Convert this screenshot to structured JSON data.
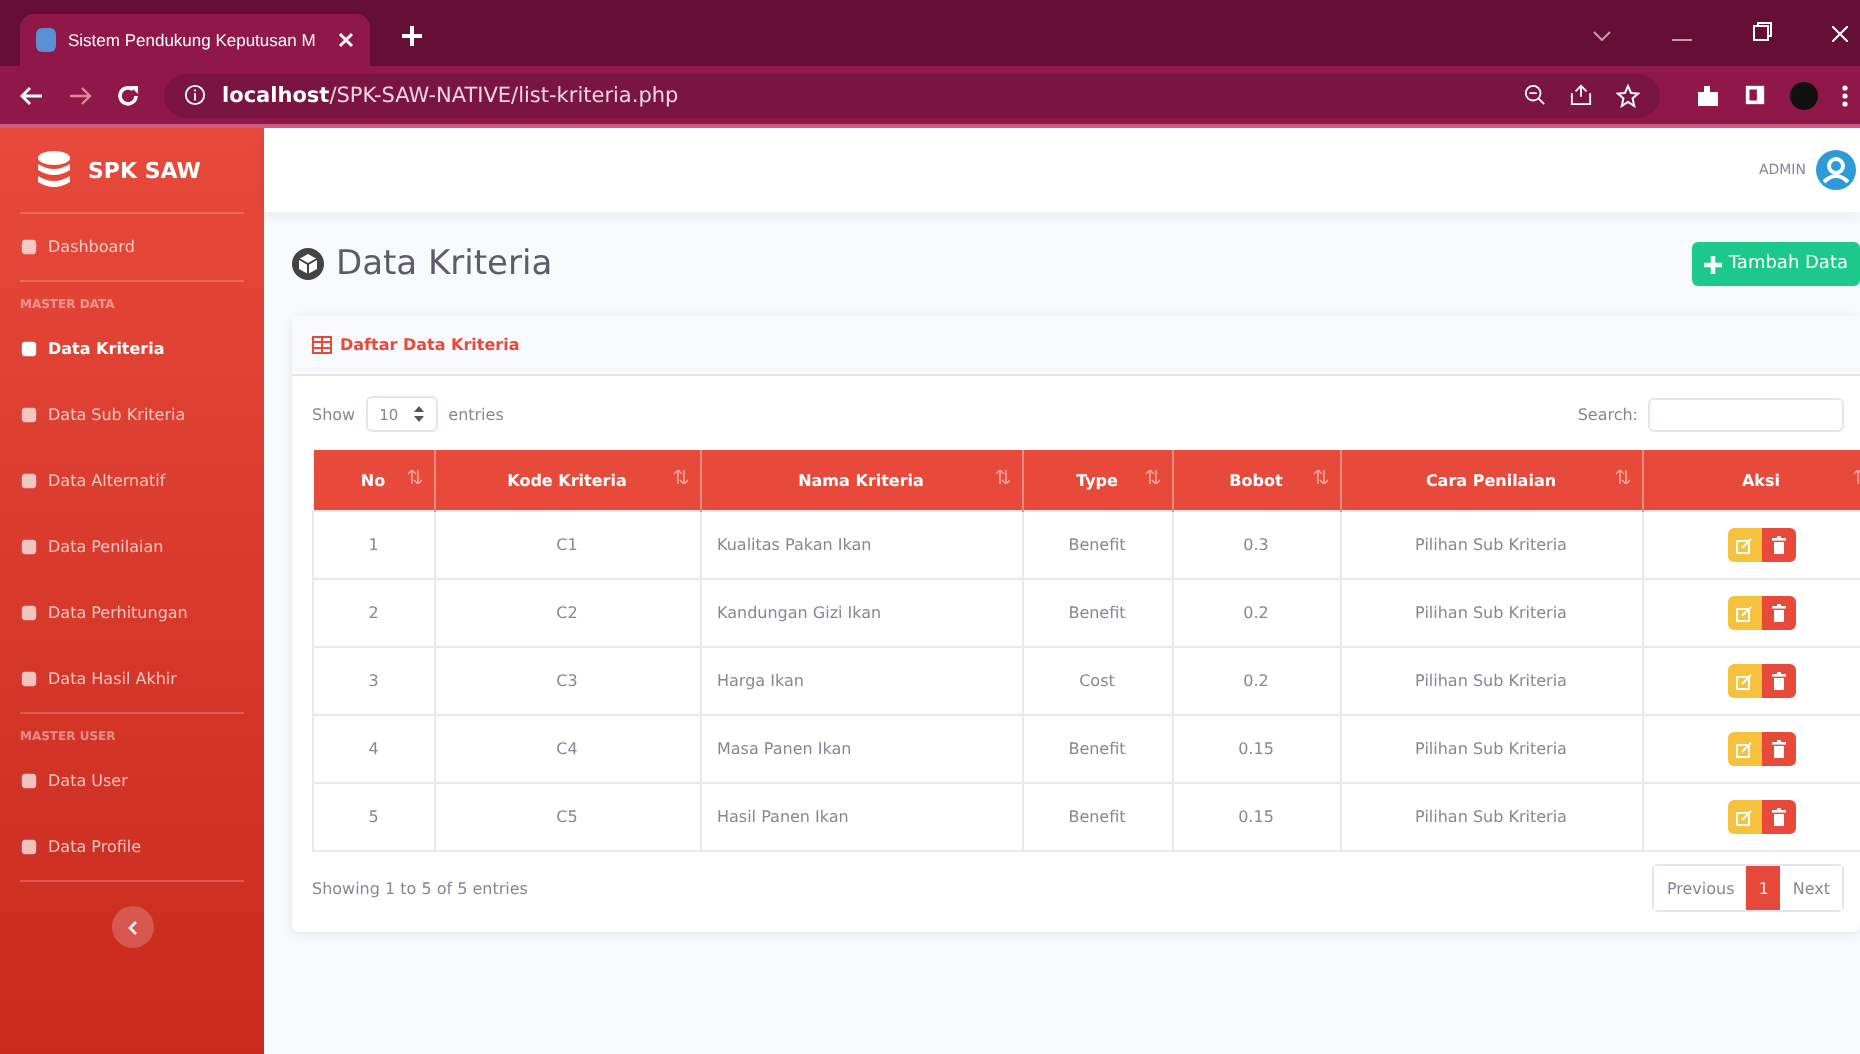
{
  "browser": {
    "tab_title": "Sistem Pendukung Keputusan M",
    "url": "**localhost**/SPK-SAW-NATIVE/list-kriteria.php"
  },
  "sidebar": {
    "brand": "SPK SAW",
    "sections": [
      {
        "items": [
          {
            "label": "Dashboard",
            "selected": false
          }
        ]
      },
      {
        "heading": "MASTER DATA",
        "items": [
          {
            "label": "Data Kriteria",
            "selected": true
          },
          {
            "label": "Data Sub Kriteria",
            "selected": false
          },
          {
            "label": "Data Alternatif",
            "selected": false
          },
          {
            "label": "Data Penilaian",
            "selected": false
          },
          {
            "label": "Data Perhitungan",
            "selected": false
          },
          {
            "label": "Data Hasil Akhir",
            "selected": false
          }
        ]
      },
      {
        "heading": "MASTER USER",
        "items": [
          {
            "label": "Data User",
            "selected": false
          },
          {
            "label": "Data Profile",
            "selected": false
          }
        ]
      }
    ]
  },
  "topbar": {
    "user": "ADMIN"
  },
  "page": {
    "title": "Data Kriteria",
    "add_button": "Tambah Data"
  },
  "card": {
    "title": "Daftar Data Kriteria",
    "show_label": "Show",
    "entries_value": "10",
    "entries_label": "entries",
    "search_label": "Search:",
    "table": {
      "columns": [
        "No",
        "Kode Kriteria",
        "Nama Kriteria",
        "Type",
        "Bobot",
        "Cara Penilaian",
        "Aksi"
      ],
      "rows": [
        [
          "1",
          "C1",
          "Kualitas Pakan Ikan",
          "Benefit",
          "0.3",
          "Pilihan Sub Kriteria"
        ],
        [
          "2",
          "C2",
          "Kandungan Gizi Ikan",
          "Benefit",
          "0.2",
          "Pilihan Sub Kriteria"
        ],
        [
          "3",
          "C3",
          "Harga Ikan",
          "Cost",
          "0.2",
          "Pilihan Sub Kriteria"
        ],
        [
          "4",
          "C4",
          "Masa Panen Ikan",
          "Benefit",
          "0.15",
          "Pilihan Sub Kriteria"
        ],
        [
          "5",
          "C5",
          "Hasil Panen Ikan",
          "Benefit",
          "0.15",
          "Pilihan Sub Kriteria"
        ]
      ]
    },
    "info": "Showing 1 to 5 of 5 entries",
    "pagination": [
      {
        "label": "Previous",
        "selected": false
      },
      {
        "label": "1",
        "selected": true
      },
      {
        "label": "Next",
        "selected": false
      }
    ]
  }
}
